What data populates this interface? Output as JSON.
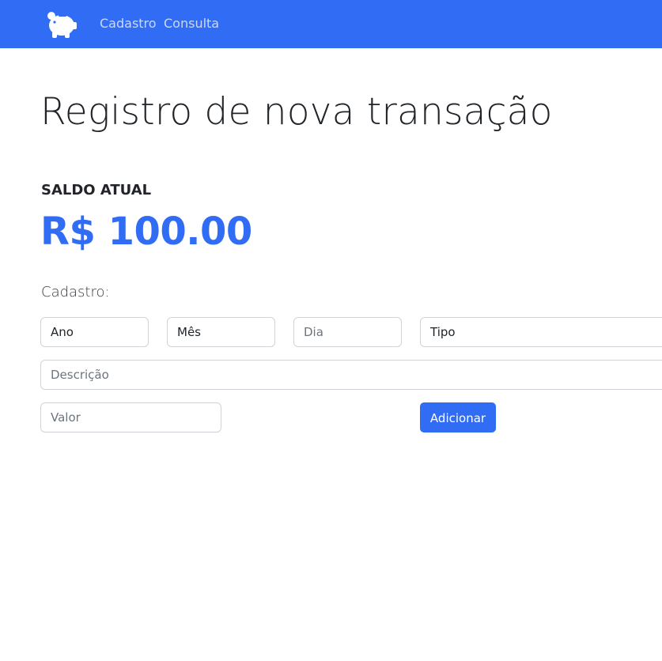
{
  "navbar": {
    "logo_icon": "piggy-bank-icon",
    "links": [
      {
        "label": "Cadastro"
      },
      {
        "label": "Consulta"
      }
    ],
    "background_color": "#316cf4"
  },
  "main": {
    "title": "Registro de nova transação",
    "balance": {
      "label": "SALDO ATUAL",
      "value": "R$ 100.00",
      "color": "#316cf4"
    },
    "form": {
      "section_label": "Cadastro:",
      "ano": {
        "value": "Ano"
      },
      "mes": {
        "value": "Mês"
      },
      "dia": {
        "placeholder": "Dia"
      },
      "tipo": {
        "value": "Tipo"
      },
      "descricao": {
        "placeholder": "Descrição"
      },
      "valor": {
        "placeholder": "Valor"
      },
      "submit_label": "Adicionar"
    }
  }
}
